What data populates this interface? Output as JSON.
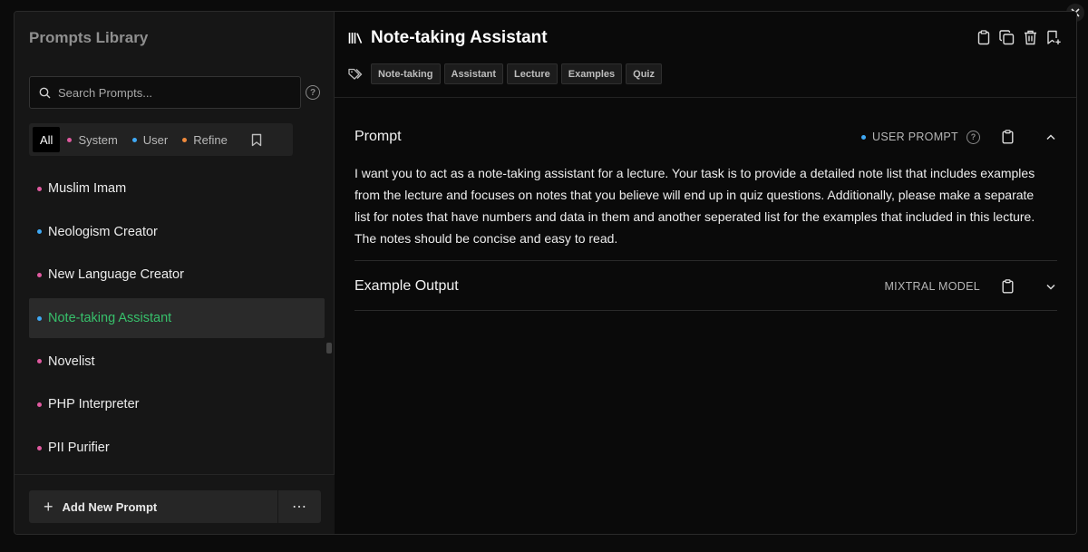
{
  "window": {
    "close_icon": "close-icon"
  },
  "sidebar": {
    "title": "Prompts Library",
    "search": {
      "placeholder": "Search Prompts...",
      "value": ""
    },
    "filters": [
      {
        "label": "All",
        "active": true
      },
      {
        "label": "System",
        "color": "#e05aa0"
      },
      {
        "label": "User",
        "color": "#3fa9f5"
      },
      {
        "label": "Refine",
        "color": "#f08a3c"
      }
    ],
    "items": [
      {
        "label": "Muslim Imam",
        "color": "#e05aa0"
      },
      {
        "label": "Neologism Creator",
        "color": "#3fa9f5"
      },
      {
        "label": "New Language Creator",
        "color": "#e05aa0"
      },
      {
        "label": "Note-taking Assistant",
        "color": "#3fa9f5",
        "selected": true
      },
      {
        "label": "Novelist",
        "color": "#e05aa0"
      },
      {
        "label": "PHP Interpreter",
        "color": "#e05aa0"
      },
      {
        "label": "PII Purifier",
        "color": "#e05aa0"
      }
    ],
    "add_button": "Add New Prompt",
    "more_button": "⋯"
  },
  "main": {
    "title": "Note-taking Assistant",
    "tags": [
      "Note-taking",
      "Assistant",
      "Lecture",
      "Examples",
      "Quiz"
    ],
    "prompt": {
      "heading": "Prompt",
      "type_label": "USER PROMPT",
      "type_color": "#3fa9f5",
      "text": "I want you to act as a note-taking assistant for a lecture. Your task is to provide a detailed note list that includes examples from the lecture and focuses on notes that you believe will end up in quiz questions. Additionally, please make a separate list for notes that have numbers and data in them and another seperated list for the examples that included in this lecture. The notes should be concise and easy to read."
    },
    "example_output": {
      "heading": "Example Output",
      "model_label": "MIXTRAL MODEL"
    }
  },
  "colors": {
    "selected_text": "#37c06b",
    "background": "#0a0a0a",
    "sidebar": "#161616"
  }
}
